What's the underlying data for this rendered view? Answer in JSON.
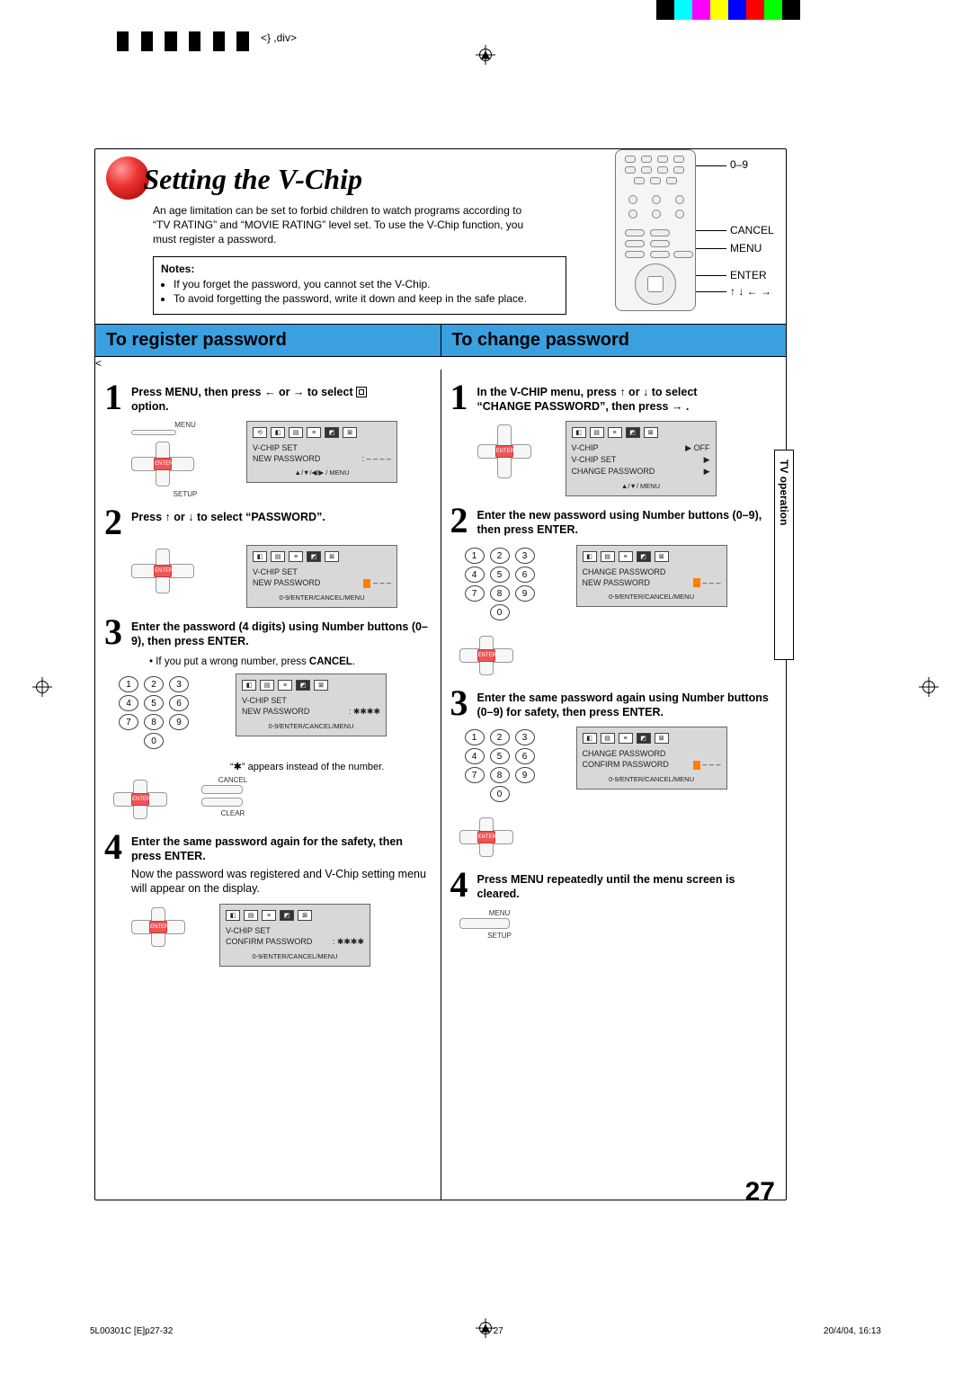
{
  "page": {
    "title": "Setting the V-Chip",
    "intro": "An age limitation can be set to forbid children to watch programs according to “TV RATING” and “MOVIE RATING” level set. To use the V-Chip function, you must register a password.",
    "side_tab": "TV operation",
    "pagenum": "27"
  },
  "notes": {
    "heading": "Notes:",
    "items": [
      "If you forget the password, you cannot set the V-Chip.",
      "To avoid forgetting the password, write it down and keep in the safe place."
    ]
  },
  "remote_labels": {
    "numbers": "0–9",
    "cancel": "CANCEL",
    "menu": "MENU",
    "enter": "ENTER",
    "arrows": "↑ ↓ ← →"
  },
  "sections": {
    "left": "To register password",
    "right": "To change password"
  },
  "left_steps": {
    "s1": "Press MENU, then press ← or → to select",
    "s1b": "option.",
    "s2": "Press ↑ or ↓ to select “PASSWORD”.",
    "s3": "Enter the password (4 digits) using Number buttons (0–9), then press ENTER.",
    "s3_sub1": "If you put a wrong number, press",
    "s3_sub2": "CANCEL",
    "s3_star": "“✱” appears instead of the number.",
    "s4": "Enter the same password again for the safety, then press ENTER.",
    "s4_sub": "Now the password was registered and V-Chip setting menu will appear on the display."
  },
  "right_steps": {
    "s1a": "In the V-CHIP menu, press ↑ or ↓ to select",
    "s1b": "“CHANGE PASSWORD”, then press → .",
    "s2": "Enter the new password using Number buttons (0–9), then press ENTER.",
    "s3": "Enter the same password again using Number buttons (0–9) for safety, then press ENTER.",
    "s4": "Press MENU repeatedly until the menu screen is cleared."
  },
  "screens": {
    "vchip_set": "V-CHIP  SET",
    "new_password": "NEW PASSWORD",
    "confirm_password": "CONFIRM PASSWORD",
    "change_password": "CHANGE  PASSWORD",
    "vchip": "V-CHIP",
    "off": "OFF",
    "hint1": "▲/▼/◀/▶ / MENU",
    "hint2": "0-9/ENTER/CANCEL/MENU",
    "hint3": "▲/▼/ MENU",
    "dashes": ": – – – –",
    "stars": ": ✱✱✱✱"
  },
  "minilabels": {
    "menu": "MENU",
    "setup": "SETUP",
    "enter": "ENTER",
    "cancel": "CANCEL",
    "clear": "CLEAR"
  },
  "footer": {
    "left": "5L00301C [E]p27-32",
    "mid": "27",
    "right": "20/4/04, 16:13"
  }
}
